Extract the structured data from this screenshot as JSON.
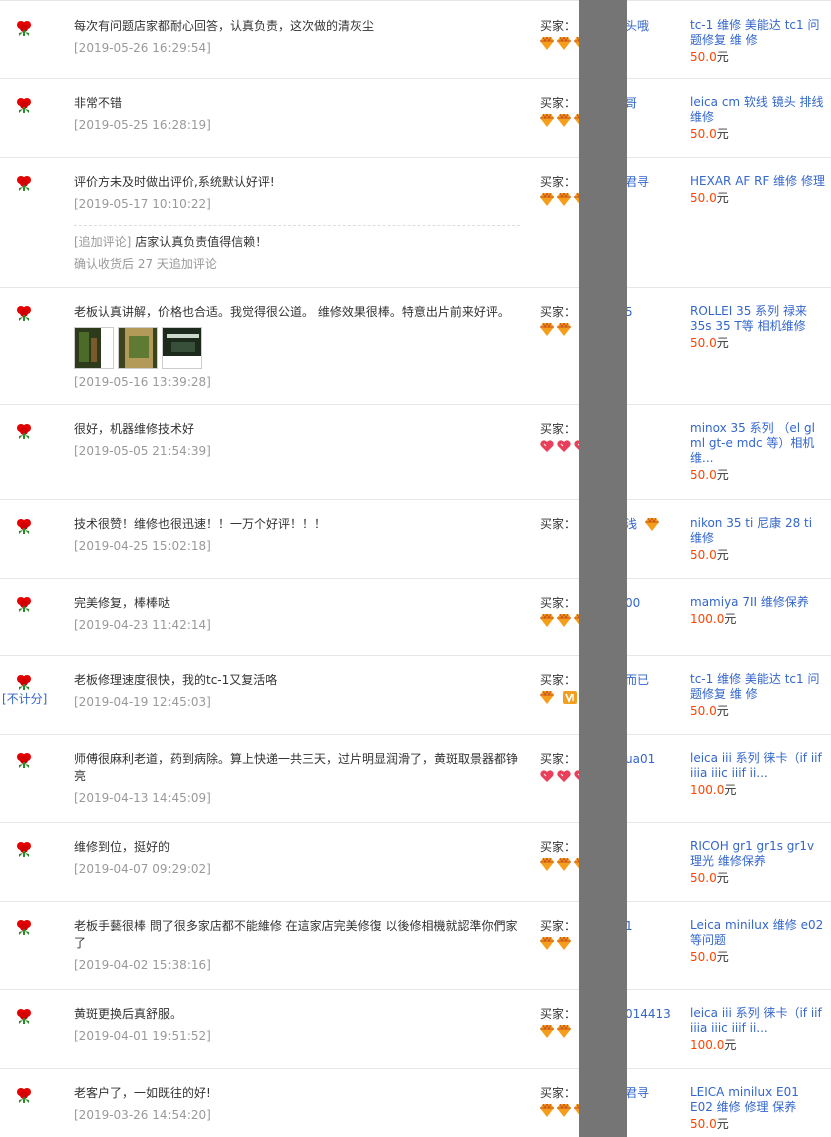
{
  "buyer_label": "买家：",
  "currency": "元",
  "rows": [
    {
      "text": "每次有问题店家都耐心回答，认真负责，这次做的清灰尘",
      "date": "[2019-05-26 16:29:54]",
      "buyer": "头哦",
      "item": "tc-1 维修 美能达 tc1 问题修复 维 修",
      "price": "50.0",
      "gem_count": 3,
      "gem_type": "diamond"
    },
    {
      "text": "非常不错",
      "date": "[2019-05-25 16:28:19]",
      "buyer": "哥",
      "item": "leica cm 软线 镜头 排线维修",
      "price": "50.0",
      "gem_count": 3,
      "gem_type": "diamond"
    },
    {
      "text": "评价方未及时做出评价,系统默认好评!",
      "date": "[2019-05-17 10:10:22]",
      "append_tag": "[追加评论]",
      "append_text": "店家认真负责值得信赖！",
      "append_meta": "确认收货后 27 天追加评论",
      "buyer": "君寻",
      "item": "HEXAR AF RF 维修 修理",
      "price": "50.0",
      "gem_count": 3,
      "gem_type": "diamond"
    },
    {
      "text": "老板认真讲解，价格也合适。我觉得很公道。 维修效果很棒。特意出片前来好评。",
      "date": "[2019-05-16 13:39:28]",
      "photos": 3,
      "buyer": "5",
      "item": "ROLLEI 35 系列 禄来35s 35 T等 相机维修",
      "price": "50.0",
      "gem_count": 2,
      "gem_type": "diamond"
    },
    {
      "text": "很好，机器维修技术好",
      "date": "[2019-05-05 21:54:39]",
      "buyer": "",
      "item": "minox 35 系列 （el gl ml gt-e mdc 等）相机维...",
      "price": "50.0",
      "gem_count": 3,
      "gem_type": "heart"
    },
    {
      "text": "技术很赞！维修也很迅速！！一万个好评！！！",
      "date": "[2019-04-25 15:02:18]",
      "buyer": "浅",
      "item": "nikon 35 ti 尼康 28 ti 维修",
      "price": "50.0",
      "gem_count": 0,
      "gem_type": "diamond"
    },
    {
      "text": "完美修复，棒棒哒",
      "date": "[2019-04-23 11:42:14]",
      "buyer": "00",
      "item": "mamiya 7II 维修保养",
      "price": "100.0",
      "gem_count": 3,
      "gem_type": "diamond"
    },
    {
      "text": "老板修理速度很快，我的tc-1又复活咯",
      "date": "[2019-04-19 12:45:03]",
      "no_count": "[不计分]",
      "buyer": "而已",
      "item": "tc-1 维修 美能达 tc1 问题修复 维 修",
      "price": "50.0",
      "gem_count": 1,
      "gem_type": "diamond"
    },
    {
      "text": "师傅很麻利老道，药到病除。算上快递一共三天，过片明显润滑了，黄斑取景器都铮亮",
      "date": "[2019-04-13 14:45:09]",
      "buyer": "ua01",
      "item": "leica iii 系列 徕卡（if iif iiia iiic iiif ii...",
      "price": "100.0",
      "gem_count": 3,
      "gem_type": "heart"
    },
    {
      "text": "维修到位，挺好的",
      "date": "[2019-04-07 09:29:02]",
      "buyer": "",
      "item": "RICOH gr1 gr1s gr1v 理光 维修保养",
      "price": "50.0",
      "gem_count": 3,
      "gem_type": "diamond"
    },
    {
      "text": "老板手藝很棒 問了很多家店都不能維修 在這家店完美修復 以後修相機就認準你們家了",
      "date": "[2019-04-02 15:38:16]",
      "buyer": "1",
      "item": "Leica minilux 维修 e02 等问题",
      "price": "50.0",
      "gem_count": 2,
      "gem_type": "diamond"
    },
    {
      "text": "黄斑更换后真舒服。",
      "date": "[2019-04-01 19:51:52]",
      "buyer": "014413",
      "item": "leica iii 系列 徕卡（if iif iiia iiic iiif ii...",
      "price": "100.0",
      "gem_count": 2,
      "gem_type": "diamond"
    },
    {
      "text": "老客户了，一如既往的好!",
      "date": "[2019-03-26 14:54:20]",
      "buyer": "君寻",
      "item": "LEICA minilux E01 E02 维修 修理 保养",
      "price": "50.0",
      "gem_count": 3,
      "gem_type": "diamond"
    }
  ]
}
